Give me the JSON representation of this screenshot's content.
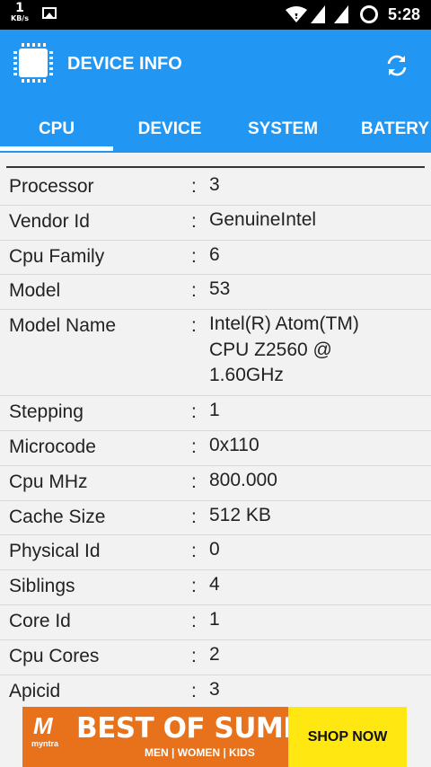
{
  "status_bar": {
    "speed_value": "1",
    "speed_unit": "KB/s",
    "time": "5:28"
  },
  "app": {
    "title": "DEVICE INFO",
    "accent_color": "#2196f3",
    "icons": {
      "logo": "processor-chip-icon",
      "refresh": "refresh-icon"
    }
  },
  "tabs": [
    {
      "label": "CPU",
      "selected": true
    },
    {
      "label": "DEVICE",
      "selected": false
    },
    {
      "label": "SYSTEM",
      "selected": false
    },
    {
      "label": "BATERY",
      "selected": false
    }
  ],
  "separator": ":",
  "cpu_info": [
    {
      "label": "Processor",
      "value": "3"
    },
    {
      "label": "Vendor Id",
      "value": "GenuineIntel"
    },
    {
      "label": "Cpu Family",
      "value": "6"
    },
    {
      "label": "Model",
      "value": "53"
    },
    {
      "label": "Model Name",
      "value": "Intel(R) Atom(TM)\nCPU Z2560  @\n1.60GHz"
    },
    {
      "label": "Stepping",
      "value": "1"
    },
    {
      "label": "Microcode",
      "value": "0x110"
    },
    {
      "label": "Cpu MHz",
      "value": "800.000"
    },
    {
      "label": "Cache Size",
      "value": "512 KB"
    },
    {
      "label": "Physical Id",
      "value": "0"
    },
    {
      "label": "Siblings",
      "value": "4"
    },
    {
      "label": "Core Id",
      "value": "1"
    },
    {
      "label": "Cpu Cores",
      "value": "2"
    },
    {
      "label": "Apicid",
      "value": "3"
    }
  ],
  "ad": {
    "brand_mark": "M",
    "brand_name": "myntra",
    "headline": "BEST OF SUMMER",
    "subline": "MEN | WOMEN | KIDS",
    "cta": "SHOP NOW"
  }
}
